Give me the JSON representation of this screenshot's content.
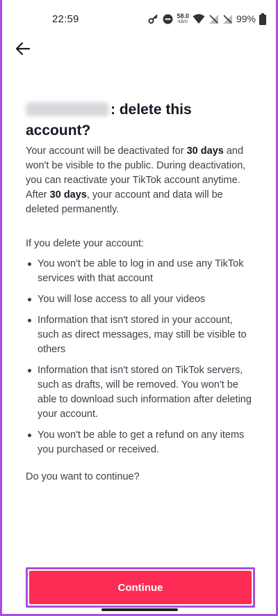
{
  "status_bar": {
    "time": "22:59",
    "net_speed_value": "58.0",
    "net_speed_unit": "KB/S",
    "battery": "99%",
    "icons": [
      "key-icon",
      "do-not-disturb-icon",
      "wifi-icon",
      "no-signal-icon",
      "no-signal-icon",
      "battery-icon"
    ]
  },
  "header": {
    "back_icon": "arrow-left-icon"
  },
  "title": {
    "suffix": ": delete this",
    "line2": "account?"
  },
  "body": {
    "p1_part1": "Your account will be deactivated for ",
    "p1_bold1": "30 days",
    "p1_part2": " and won't be visible to the public. During deactivation, you can reactivate your TikTok account anytime.",
    "p2_part1": "After ",
    "p2_bold": "30 days",
    "p2_part2": ", your account and data will be deleted permanently.",
    "intro": "If you delete your account:",
    "bullets": [
      "You won't be able to log in and use any TikTok services with that account",
      "You will lose access to all your videos",
      "Information that isn't stored in your account, such as direct messages, may still be visible to others",
      "Information that isn't stored on TikTok servers, such as drafts, will be removed. You won't be able to download such information after deleting your account.",
      "You won't be able to get a refund on any items you purchased or received."
    ],
    "question": "Do you want to continue?"
  },
  "footer": {
    "continue_label": "Continue"
  },
  "colors": {
    "accent": "#fe2c55",
    "highlight_border": "#a94fe0",
    "text_primary": "#161823",
    "text_body": "#3d3f48"
  }
}
